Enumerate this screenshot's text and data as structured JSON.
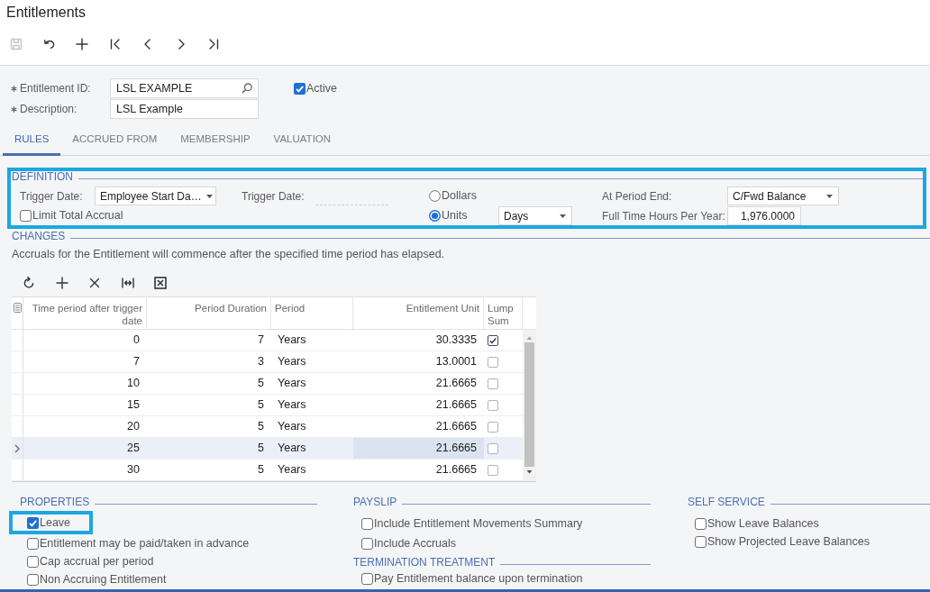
{
  "page": {
    "title": "Entitlements"
  },
  "toolbar": [
    {
      "kind": "save",
      "disabled": true
    },
    {
      "kind": "undo",
      "disabled": false
    },
    {
      "kind": "add",
      "disabled": false
    },
    {
      "kind": "first",
      "disabled": false
    },
    {
      "kind": "previous",
      "disabled": false
    },
    {
      "kind": "next",
      "disabled": false
    },
    {
      "kind": "last",
      "disabled": false
    }
  ],
  "summary": {
    "entitlement_id": {
      "label": "Entitlement ID:",
      "required": true,
      "value": "LSL EXAMPLE"
    },
    "description": {
      "label": "Description:",
      "required": true,
      "value": "LSL Example"
    },
    "active": {
      "label": "Active",
      "checked": true
    }
  },
  "tabs": [
    {
      "label": "RULES",
      "selected": true
    },
    {
      "label": "ACCRUED FROM",
      "selected": false
    },
    {
      "label": "MEMBERSHIP",
      "selected": false
    },
    {
      "label": "VALUATION",
      "selected": false
    }
  ],
  "definition": {
    "title": "DEFINITION",
    "highlighted": true,
    "trigger_date": {
      "label": "Trigger Date:",
      "value": "Employee Start Da…"
    },
    "trigger_date_2": {
      "label": "Trigger Date:",
      "disabled": true
    },
    "limit_total_accrual": {
      "label": "Limit Total Accrual",
      "checked": false
    },
    "accrual_type": [
      {
        "label": "Dollars",
        "selected": false
      },
      {
        "label": "Units",
        "selected": true
      }
    ],
    "unit": {
      "value": "Days"
    },
    "at_period_end": {
      "label": "At Period End:",
      "value": "C/Fwd Balance"
    },
    "full_time_hours": {
      "label": "Full Time Hours Per Year:",
      "value": "1,976.0000"
    }
  },
  "changes": {
    "title": "CHANGES",
    "note": "Accruals for the Entitlement will commence after the specified time period has elapsed.",
    "toolbar": [
      {
        "kind": "refresh"
      },
      {
        "kind": "add"
      },
      {
        "kind": "delete"
      },
      {
        "kind": "fit_columns"
      },
      {
        "kind": "export_excel"
      }
    ],
    "table": {
      "columns": [
        {
          "label": "Time period after trigger date",
          "kind": "number"
        },
        {
          "label": "Period Duration",
          "kind": "number"
        },
        {
          "label": "Period",
          "kind": "text"
        },
        {
          "label": "Entitlement Unit",
          "kind": "number"
        },
        {
          "label": "Lump Sum",
          "kind": "checkbox"
        }
      ],
      "rows": [
        {
          "selected": false,
          "cells": [
            {
              "value": "0",
              "focused": false
            },
            {
              "value": "7",
              "focused": false
            },
            {
              "value": "Years",
              "focused": false
            },
            {
              "value": "30.3335",
              "focused": false
            },
            {
              "checked": true,
              "focused": false
            }
          ]
        },
        {
          "selected": false,
          "cells": [
            {
              "value": "7",
              "focused": false
            },
            {
              "value": "3",
              "focused": false
            },
            {
              "value": "Years",
              "focused": false
            },
            {
              "value": "13.0001",
              "focused": false
            },
            {
              "checked": false,
              "focused": false
            }
          ]
        },
        {
          "selected": false,
          "cells": [
            {
              "value": "10",
              "focused": false
            },
            {
              "value": "5",
              "focused": false
            },
            {
              "value": "Years",
              "focused": false
            },
            {
              "value": "21.6665",
              "focused": false
            },
            {
              "checked": false,
              "focused": false
            }
          ]
        },
        {
          "selected": false,
          "cells": [
            {
              "value": "15",
              "focused": false
            },
            {
              "value": "5",
              "focused": false
            },
            {
              "value": "Years",
              "focused": false
            },
            {
              "value": "21.6665",
              "focused": false
            },
            {
              "checked": false,
              "focused": false
            }
          ]
        },
        {
          "selected": false,
          "cells": [
            {
              "value": "20",
              "focused": false
            },
            {
              "value": "5",
              "focused": false
            },
            {
              "value": "Years",
              "focused": false
            },
            {
              "value": "21.6665",
              "focused": false
            },
            {
              "checked": false,
              "focused": false
            }
          ]
        },
        {
          "selected": true,
          "cells": [
            {
              "value": "25",
              "focused": false
            },
            {
              "value": "5",
              "focused": false
            },
            {
              "value": "Years",
              "focused": false
            },
            {
              "value": "21.6665",
              "focused": true
            },
            {
              "checked": false,
              "focused": false
            }
          ]
        },
        {
          "selected": false,
          "cells": [
            {
              "value": "30",
              "focused": false
            },
            {
              "value": "5",
              "focused": false
            },
            {
              "value": "Years",
              "focused": false
            },
            {
              "value": "21.6665",
              "focused": false
            },
            {
              "checked": false,
              "focused": false
            }
          ]
        }
      ]
    }
  },
  "properties": {
    "title": "PROPERTIES",
    "items": [
      {
        "label": "Leave",
        "checked": true,
        "highlighted": true
      },
      {
        "label": "Entitlement may be paid/taken in advance",
        "checked": false,
        "highlighted": false
      },
      {
        "label": "Cap accrual per period",
        "checked": false,
        "highlighted": false
      },
      {
        "label": "Non Accruing Entitlement",
        "checked": false,
        "highlighted": false
      }
    ]
  },
  "payslip": {
    "title": "PAYSLIP",
    "items": [
      {
        "label": "Include Entitlement Movements Summary",
        "checked": false
      },
      {
        "label": "Include Accruals",
        "checked": false
      }
    ]
  },
  "termination_treatment": {
    "title": "TERMINATION TREATMENT",
    "items": [
      {
        "label": "Pay Entitlement balance upon termination",
        "checked": false
      }
    ]
  },
  "self_service": {
    "title": "SELF SERVICE",
    "items": [
      {
        "label": "Show Leave Balances",
        "checked": false
      },
      {
        "label": "Show Projected Leave Balances",
        "checked": false
      }
    ]
  }
}
